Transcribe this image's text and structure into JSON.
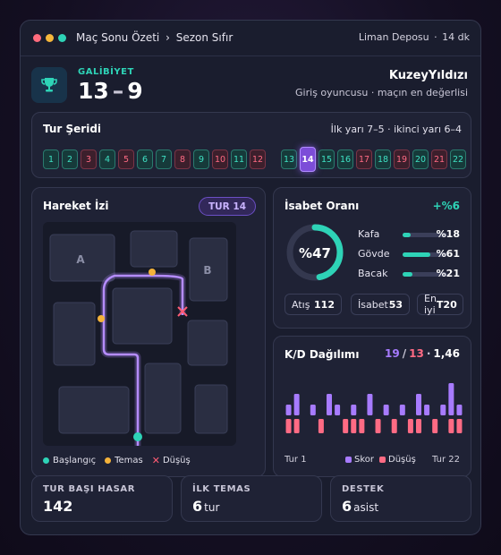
{
  "window": {
    "breadcrumb": {
      "current": "Maç Sonu Özeti",
      "separator": "›",
      "next": "Sezon Sıfır"
    },
    "meta": {
      "map": "Liman Deposu",
      "separator": "·",
      "duration": "14 dk"
    }
  },
  "header": {
    "result_label": "GALİBİYET",
    "score_team": "13",
    "score_dash": "–",
    "score_enemy": "9",
    "player_name": "KuzeyYıldızı",
    "player_subtitle": "Giriş oyuncusu · maçın en değerlisi",
    "trophy_icon": "trophy-icon"
  },
  "round_strip": {
    "title": "Tur Şeridi",
    "halves_summary": "İlk yarı 7–5 · ikinci yarı 6–4",
    "current_round": 14,
    "rounds": [
      {
        "n": "1",
        "result": "win"
      },
      {
        "n": "2",
        "result": "win"
      },
      {
        "n": "3",
        "result": "loss"
      },
      {
        "n": "4",
        "result": "win"
      },
      {
        "n": "5",
        "result": "loss"
      },
      {
        "n": "6",
        "result": "win"
      },
      {
        "n": "7",
        "result": "win"
      },
      {
        "n": "8",
        "result": "loss"
      },
      {
        "n": "9",
        "result": "win"
      },
      {
        "n": "10",
        "result": "loss"
      },
      {
        "n": "11",
        "result": "win"
      },
      {
        "n": "12",
        "result": "loss"
      },
      {
        "n": "13",
        "result": "win"
      },
      {
        "n": "14",
        "result": "win"
      },
      {
        "n": "15",
        "result": "win"
      },
      {
        "n": "16",
        "result": "win"
      },
      {
        "n": "17",
        "result": "loss"
      },
      {
        "n": "18",
        "result": "win"
      },
      {
        "n": "19",
        "result": "loss"
      },
      {
        "n": "20",
        "result": "win"
      },
      {
        "n": "21",
        "result": "loss"
      },
      {
        "n": "22",
        "result": "win"
      }
    ]
  },
  "movement": {
    "title": "Hareket İzi",
    "round_badge": "TUR 14",
    "zone_a": "A",
    "zone_b": "B",
    "legend": {
      "start": "Başlangıç",
      "contact": "Temas",
      "death": "Düşüş"
    },
    "colors": {
      "path": "#a77bff",
      "start": "#2ed3b7",
      "contact": "#f4b23a",
      "death": "#ff5c74"
    }
  },
  "accuracy": {
    "title": "İsabet Oranı",
    "delta": "+%6",
    "overall_label": "%47",
    "overall_value": 47,
    "rows": [
      {
        "label": "Kafa",
        "value_label": "%18",
        "value": 18
      },
      {
        "label": "Gövde",
        "value_label": "%61",
        "value": 61
      },
      {
        "label": "Bacak",
        "value_label": "%21",
        "value": 21
      }
    ],
    "stats": [
      {
        "label": "Atış",
        "value": "112"
      },
      {
        "label": "İsabet",
        "value": "53"
      },
      {
        "label": "En iyi",
        "value": "T20"
      }
    ]
  },
  "kd": {
    "title": "K/D Dağılımı",
    "kills": "19",
    "slash": "/",
    "deaths": "13",
    "dot": "·",
    "ratio": "1,46",
    "axis_start": "Tur 1",
    "axis_end": "Tur 22",
    "legend_score": "Skor",
    "legend_death": "Düşüş",
    "colors": {
      "score": "#a77bff",
      "death": "#ff6b84",
      "kills_text": "#a77bff",
      "deaths_text": "#ff6b84"
    }
  },
  "chart_data": {
    "type": "bar",
    "categories": [
      "1",
      "2",
      "3",
      "4",
      "5",
      "6",
      "7",
      "8",
      "9",
      "10",
      "11",
      "12",
      "13",
      "14",
      "15",
      "16",
      "17",
      "18",
      "19",
      "20",
      "21",
      "22"
    ],
    "series": [
      {
        "name": "Skor",
        "values": [
          1,
          2,
          0,
          1,
          0,
          2,
          1,
          0,
          1,
          0,
          2,
          0,
          1,
          0,
          1,
          0,
          2,
          1,
          0,
          1,
          3,
          1
        ]
      },
      {
        "name": "Düşüş",
        "values": [
          1,
          1,
          0,
          0,
          1,
          0,
          0,
          1,
          1,
          1,
          0,
          1,
          0,
          1,
          0,
          1,
          1,
          0,
          1,
          0,
          1,
          1
        ]
      }
    ]
  },
  "bottom": [
    {
      "label": "TUR BAŞI HASAR",
      "value": "142",
      "unit": ""
    },
    {
      "label": "İLK TEMAS",
      "value": "6",
      "unit": "tur"
    },
    {
      "label": "DESTEK",
      "value": "6",
      "unit": "asist"
    }
  ]
}
